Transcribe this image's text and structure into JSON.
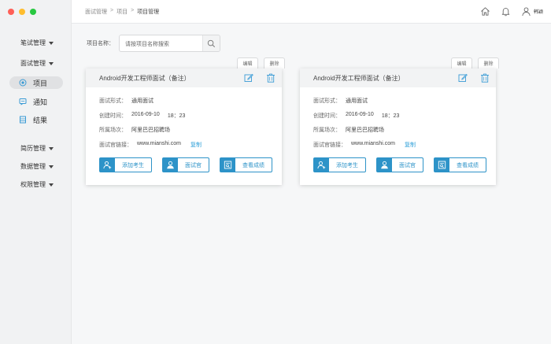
{
  "window": {
    "controls": [
      "close",
      "minimize",
      "maximize"
    ]
  },
  "sidebar": {
    "groups_top": [
      {
        "label": "笔试管理"
      },
      {
        "label": "面试管理"
      }
    ],
    "items": [
      {
        "label": "项目",
        "icon": "target-icon",
        "active": true
      },
      {
        "label": "通知",
        "icon": "message-icon",
        "active": false
      },
      {
        "label": "结果",
        "icon": "result-icon",
        "active": false
      }
    ],
    "groups_bottom": [
      {
        "label": "简历管理"
      },
      {
        "label": "数据管理"
      },
      {
        "label": "权限管理"
      }
    ]
  },
  "header": {
    "breadcrumb": [
      "面试管理",
      "项目",
      "项目管理"
    ],
    "separator": ">",
    "username": "韩颖",
    "icons": [
      "home-icon",
      "bell-icon",
      "user-icon"
    ]
  },
  "search": {
    "label": "项目名称：",
    "placeholder": "请按项目名称搜索"
  },
  "cards": [
    {
      "tab_edit": "编辑",
      "tab_delete": "删除",
      "title": "Android开发工程师面试（备注）",
      "form_label": "面试形式：",
      "form_value": "通用面试",
      "created_label": "创建时间：",
      "created_date": "2016-09-10",
      "created_time": "18：23",
      "venue_label": "所属场次：",
      "venue_value": "阿里巴巴招聘场",
      "link_label": "面试官链接：",
      "link_value": "www.mianshi.com",
      "copy": "复制",
      "btn_add": "添加考生",
      "btn_interviewer": "面试官",
      "btn_results": "查看成绩"
    },
    {
      "tab_edit": "编辑",
      "tab_delete": "删除",
      "title": "Android开发工程师面试（备注）",
      "form_label": "面试形式：",
      "form_value": "通用面试",
      "created_label": "创建时间：",
      "created_date": "2016-09-10",
      "created_time": "18：23",
      "venue_label": "所属场次：",
      "venue_value": "阿里巴巴招聘场",
      "link_label": "面试官链接：",
      "link_value": "www.mianshi.com",
      "copy": "复制",
      "btn_add": "添加考生",
      "btn_interviewer": "面试官",
      "btn_results": "查看成绩"
    }
  ],
  "colors": {
    "accent": "#2d93c8",
    "link": "#2d9fd8",
    "active_item_bg": "#e0e1e3"
  }
}
